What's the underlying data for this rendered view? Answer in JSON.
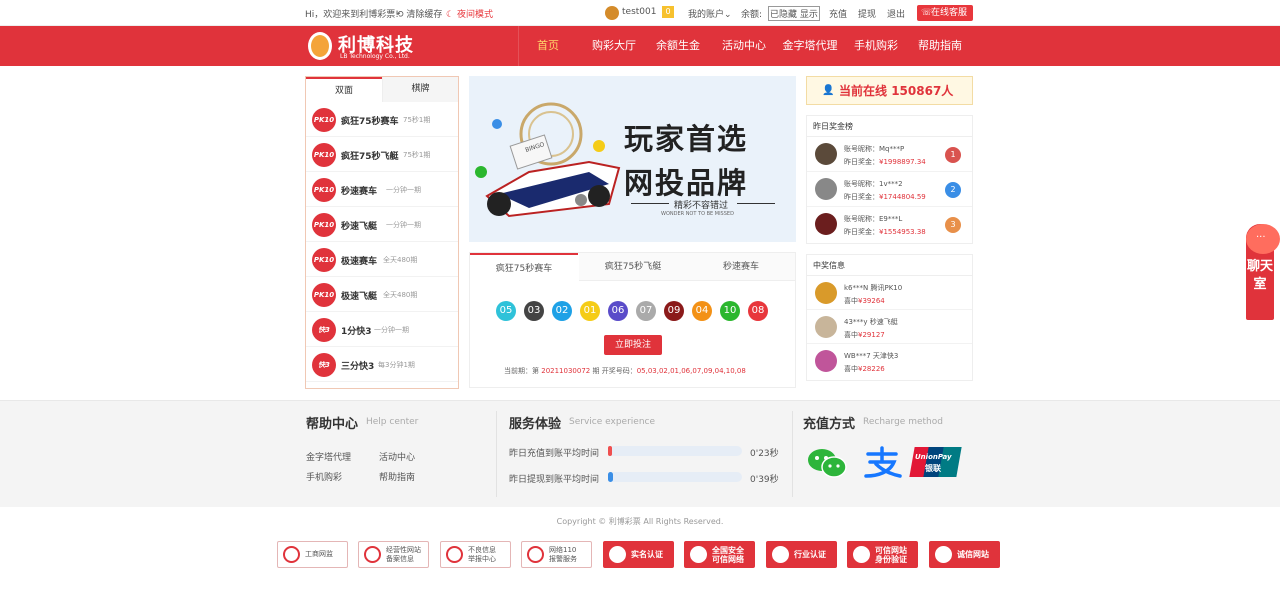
{
  "topbar": {
    "welcome": "Hi，欢迎来到利博彩票!",
    "clear_cache": "清除缓存",
    "night_mode": "夜间模式",
    "username": "test001",
    "vip": "0",
    "my_account": "我的账户",
    "balance_label": "余额:",
    "balance_value": "已隐藏 显示",
    "recharge": "充值",
    "withdraw": "提现",
    "logout": "退出",
    "service": "在线客服"
  },
  "nav": {
    "logo_name": "利博科技",
    "logo_sub": "LB Technology Co., Ltd.",
    "items": [
      "首页",
      "购彩大厅",
      "余额生金",
      "活动中心",
      "金字塔代理",
      "手机购彩",
      "帮助指南"
    ]
  },
  "games": {
    "tabs": [
      "双面",
      "棋牌"
    ],
    "list": [
      {
        "icon": "PK10",
        "name": "疯狂75秒赛车",
        "sub": "75秒1期"
      },
      {
        "icon": "PK10",
        "name": "疯狂75秒飞艇",
        "sub": "75秒1期"
      },
      {
        "icon": "PK10",
        "name": "秒速赛车",
        "sub": "一分钟一期"
      },
      {
        "icon": "PK10",
        "name": "秒速飞艇",
        "sub": "一分钟一期"
      },
      {
        "icon": "PK10",
        "name": "极速赛车",
        "sub": "全天480期"
      },
      {
        "icon": "PK10",
        "name": "极速飞艇",
        "sub": "全天480期"
      },
      {
        "icon": "快3",
        "name": "1分快3",
        "sub": "一分钟一期"
      },
      {
        "icon": "快3",
        "name": "三分快3",
        "sub": "每3分钟1期"
      }
    ]
  },
  "banner": {
    "line1": "玩家首选",
    "line2": "网投品牌",
    "line3": "精彩不容错过",
    "line4": "WONDER NOT TO BE MISSED",
    "bingo": "BINGO"
  },
  "results": {
    "tabs": [
      "疯狂75秒赛车",
      "疯狂75秒飞艇",
      "秒速赛车"
    ],
    "balls": [
      "05",
      "03",
      "02",
      "01",
      "06",
      "07",
      "09",
      "04",
      "10",
      "08"
    ],
    "ball_colors": [
      "#2fc2d9",
      "#444444",
      "#1ea1e6",
      "#f5cc17",
      "#5a4cc9",
      "#aaaaaa",
      "#8b1a1a",
      "#f39116",
      "#2bb72e",
      "#e8373c"
    ],
    "bet_button": "立即投注",
    "period_label": "当前期：第",
    "period": "20211030072",
    "period_suffix": "期 开奖号码：",
    "numbers": "05,03,02,01,06,07,09,04,10,08"
  },
  "online": {
    "label": "当前在线",
    "count": "150867人"
  },
  "rank": {
    "title": "昨日奖金榜",
    "rows": [
      {
        "nick_label": "账号昵称：",
        "nick": "Mq***P",
        "prize_label": "昨日奖金：",
        "prize": "¥1998897.34",
        "place": "1",
        "color": "#d9534f"
      },
      {
        "nick_label": "账号昵称：",
        "nick": "1v***2",
        "prize_label": "昨日奖金：",
        "prize": "¥1744804.59",
        "place": "2",
        "color": "#3a8ee6"
      },
      {
        "nick_label": "账号昵称：",
        "nick": "E9***L",
        "prize_label": "昨日奖金：",
        "prize": "¥1554953.38",
        "place": "3",
        "color": "#e8904a"
      }
    ]
  },
  "winners": {
    "title": "中奖信息",
    "rows": [
      {
        "line1": "k6***N 腾讯PK10",
        "label": "喜中",
        "amount": "¥39264"
      },
      {
        "line1": "43***y 秒速飞艇",
        "label": "喜中",
        "amount": "¥29127"
      },
      {
        "line1": "WB***7 天津快3",
        "label": "喜中",
        "amount": "¥28226"
      }
    ]
  },
  "chat": {
    "label": "聊天室"
  },
  "footer": {
    "help_title": "帮助中心",
    "help_en": "Help center",
    "help_links": [
      "金字塔代理",
      "活动中心",
      "手机购彩",
      "帮助指南"
    ],
    "service_title": "服务体验",
    "service_en": "Service experience",
    "service_rows": [
      {
        "label": "昨日充值到账平均时间",
        "time": "0'23秒",
        "fill": 0.03,
        "color": "#ef4f4f"
      },
      {
        "label": "昨日提现到账平均时间",
        "time": "0'39秒",
        "fill": 0.04,
        "color": "#3a8ee6"
      }
    ],
    "recharge_title": "充值方式",
    "recharge_en": "Recharge method",
    "unionpay": "UnionPay",
    "unionpay_cn": "银联",
    "copyright": "Copyright © 利博彩票 All Rights Reserved.",
    "badges": [
      {
        "l1": "工商网监",
        "l2": ""
      },
      {
        "l1": "经营性网站",
        "l2": "备案信息"
      },
      {
        "l1": "不良信息",
        "l2": "举报中心"
      },
      {
        "l1": "网络110",
        "l2": "报警服务"
      },
      {
        "l1": "实名认证",
        "l2": ""
      },
      {
        "l1": "全国安全",
        "l2": "可信网络"
      },
      {
        "l1": "行业认证",
        "l2": ""
      },
      {
        "l1": "可信网站",
        "l2": "身份验证"
      },
      {
        "l1": "诚信网站",
        "l2": ""
      }
    ]
  }
}
